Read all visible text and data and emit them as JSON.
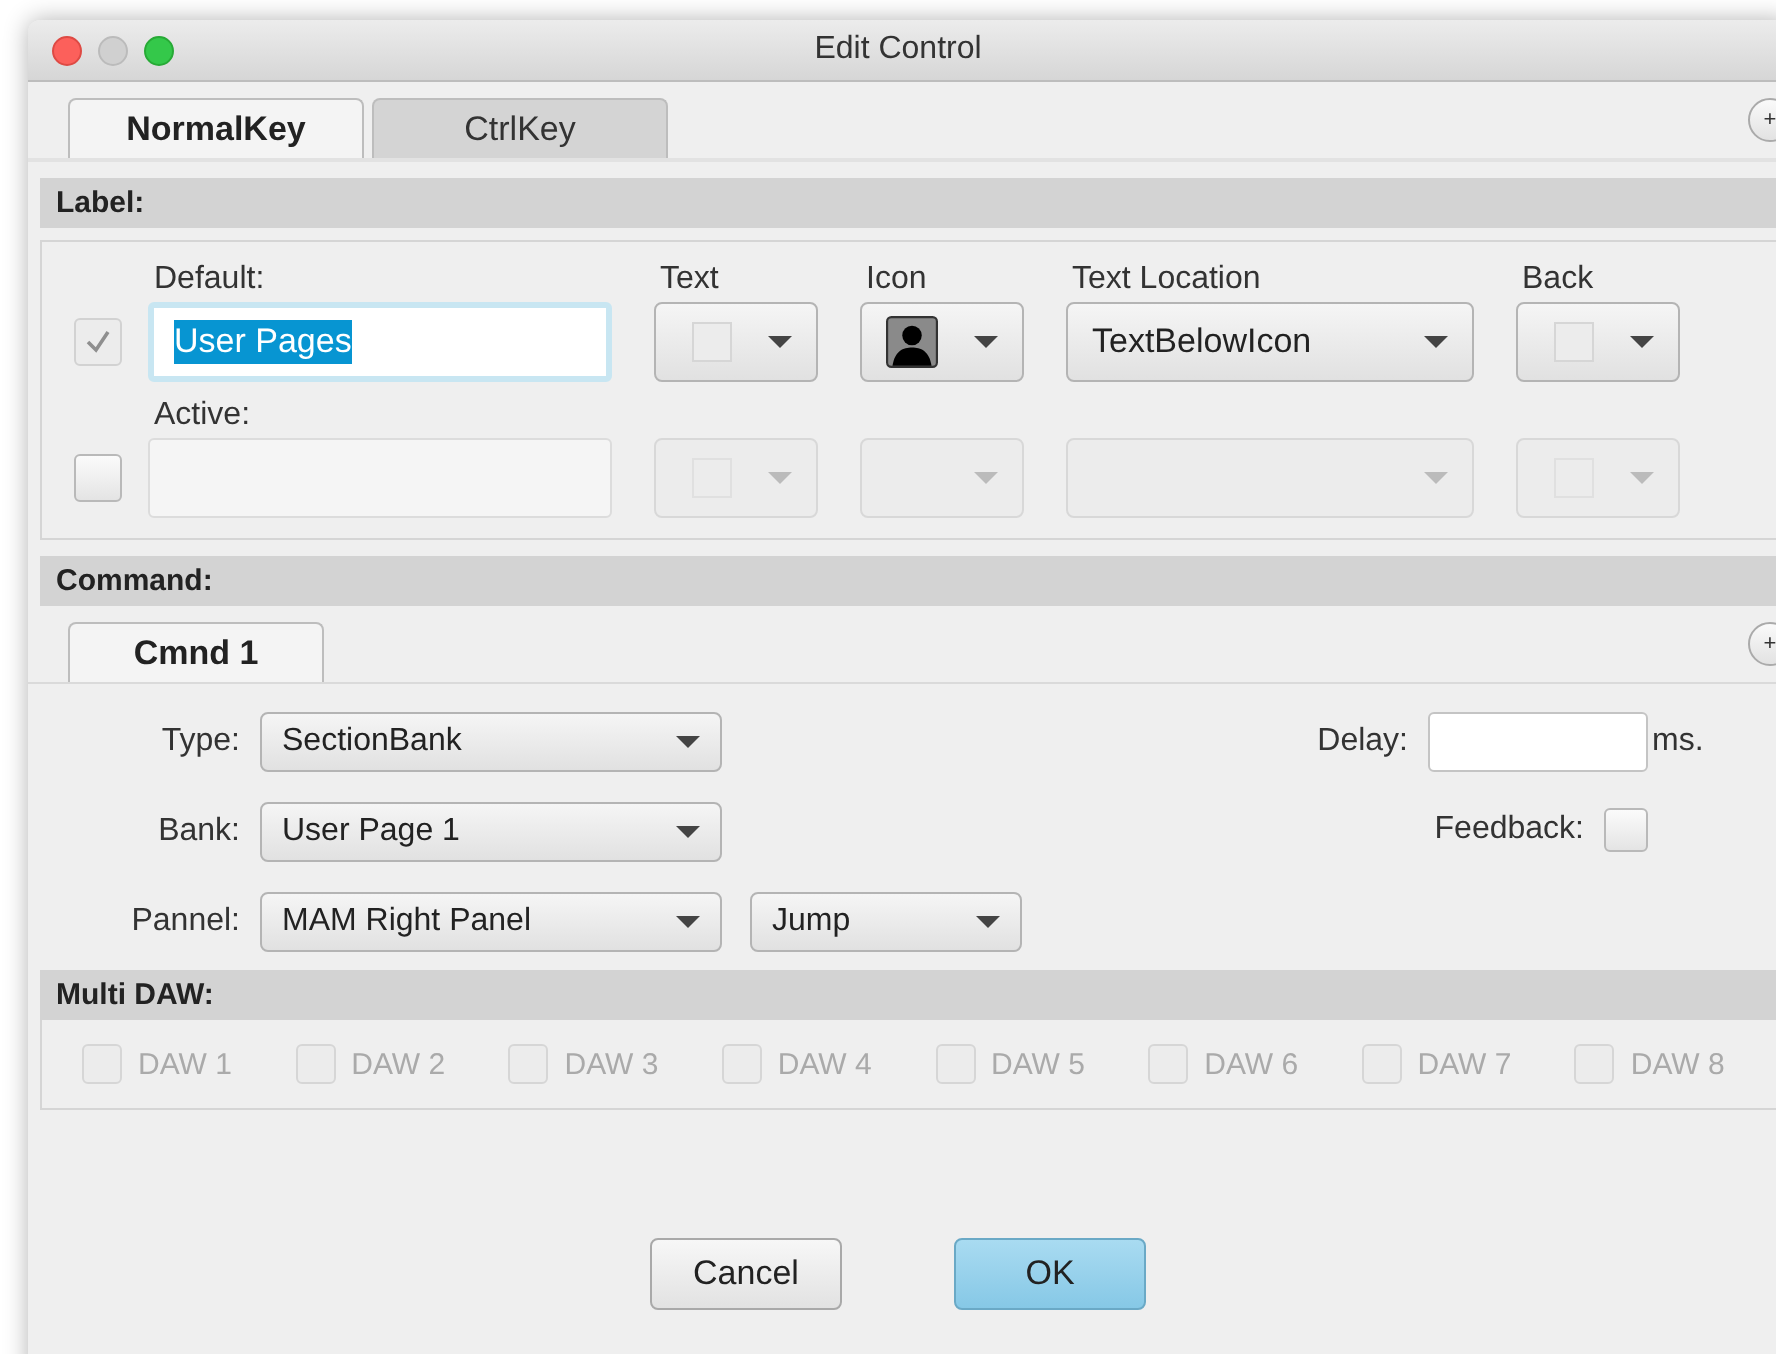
{
  "window": {
    "title": "Edit Control"
  },
  "tabs": [
    {
      "label": "NormalKey",
      "selected": true
    },
    {
      "label": "CtrlKey",
      "selected": false
    }
  ],
  "add_tab_button": "+",
  "label_section": {
    "title": "Label:",
    "columns": [
      "Text",
      "Icon",
      "Text Location",
      "Back"
    ],
    "rows": [
      {
        "label": "Default:",
        "checked": true,
        "checkbox_disabled": true,
        "value": "User Pages",
        "value_selected": true,
        "disabled": false,
        "has_icon": true,
        "text_location": "TextBelowIcon"
      },
      {
        "label": "Active:",
        "checked": false,
        "checkbox_disabled": false,
        "disabled": true,
        "has_icon": false
      }
    ]
  },
  "command_section": {
    "title": "Command:",
    "tabs": [
      {
        "label": "Cmnd 1",
        "selected": true
      }
    ],
    "add_tab_button": "+",
    "fields": [
      {
        "label": "Type:",
        "value": "SectionBank"
      },
      {
        "label": "Bank:",
        "value": "User Page 1"
      },
      {
        "label": "Pannel:",
        "value": "MAM Right Panel"
      }
    ],
    "jump": "Jump",
    "delay_label": "Delay:",
    "delay_unit": "ms.",
    "feedback_label": "Feedback:",
    "feedback_checked": false
  },
  "multi_daw": {
    "title": "Multi DAW:",
    "disabled": true,
    "items": [
      {
        "label": "DAW 1",
        "checked": false
      },
      {
        "label": "DAW 2",
        "checked": false
      },
      {
        "label": "DAW 3",
        "checked": false
      },
      {
        "label": "DAW 4",
        "checked": false
      },
      {
        "label": "DAW 5",
        "checked": false
      },
      {
        "label": "DAW 6",
        "checked": false
      },
      {
        "label": "DAW 7",
        "checked": false
      },
      {
        "label": "DAW 8",
        "checked": false
      }
    ]
  },
  "buttons": [
    {
      "label": "Cancel",
      "default": false
    },
    {
      "label": "OK",
      "default": true
    }
  ]
}
